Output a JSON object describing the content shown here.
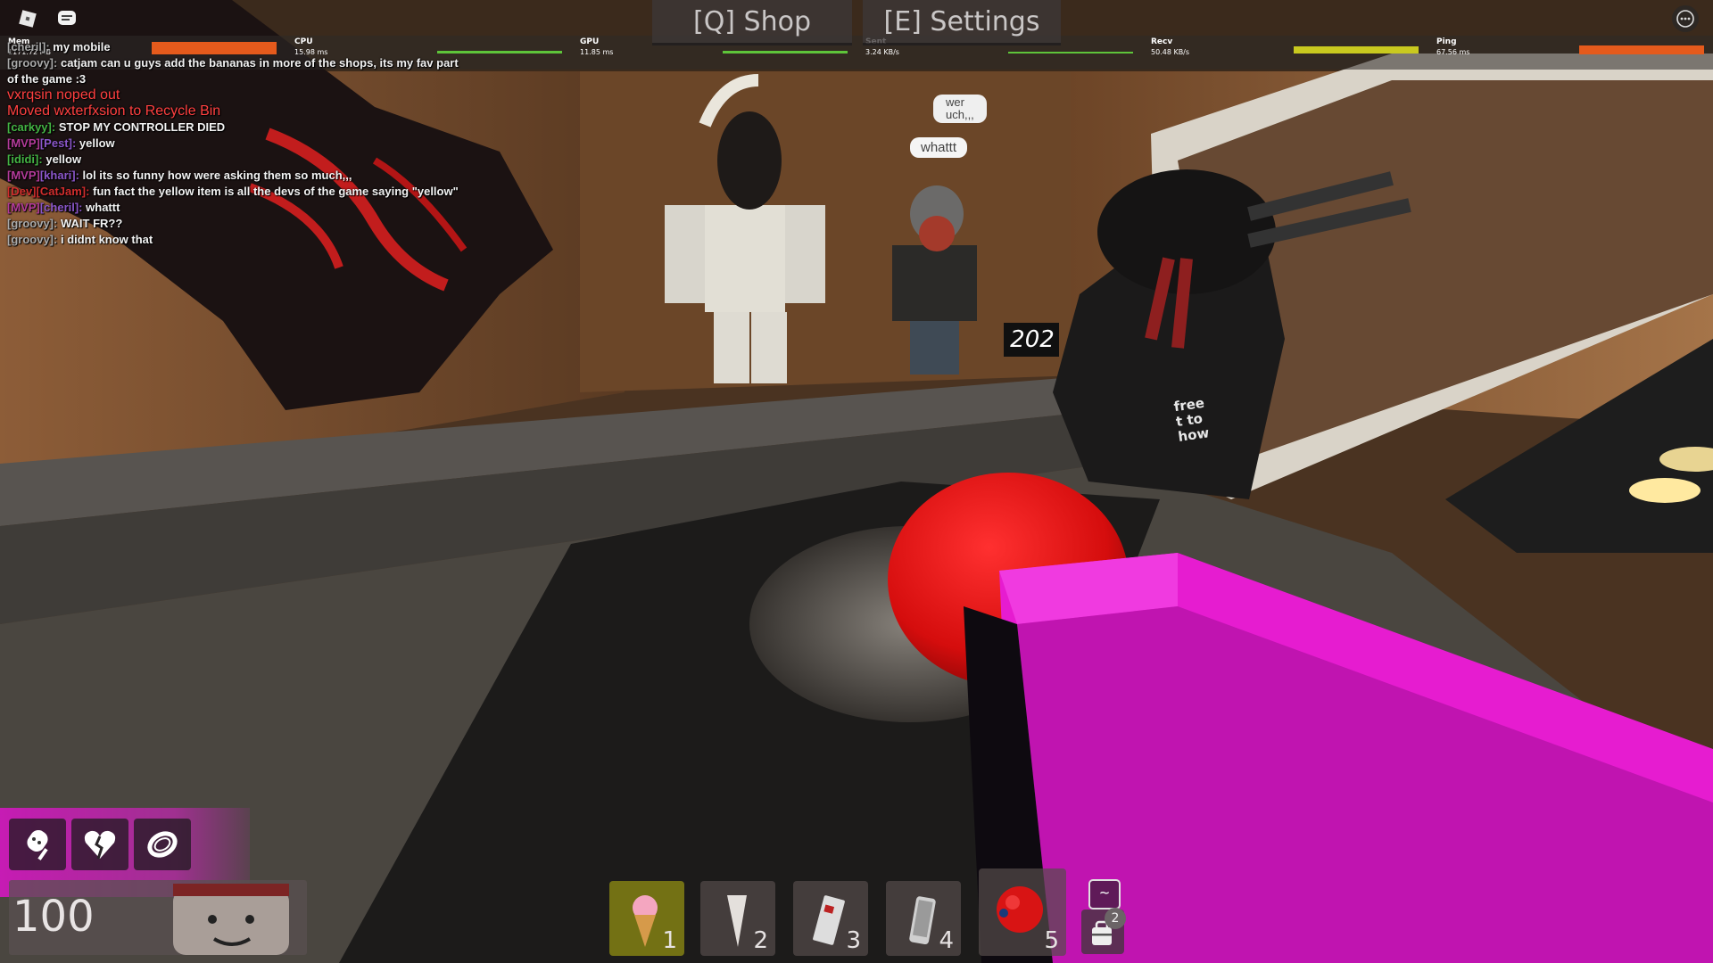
{
  "top_menu": {
    "shop_label": "[Q] Shop",
    "settings_label": "[E] Settings"
  },
  "stats": {
    "mem": {
      "label": "Mem",
      "value": "1171.72 MB"
    },
    "cpu": {
      "label": "CPU",
      "value": "15.98 ms"
    },
    "gpu": {
      "label": "GPU",
      "value": "11.85 ms"
    },
    "sent": {
      "label": "Sent",
      "value": "3.24 KB/s"
    },
    "recv": {
      "label": "Recv",
      "value": "50.48 KB/s"
    },
    "ping": {
      "label": "Ping",
      "value": "67.56 ms"
    }
  },
  "chat": {
    "messages": [
      {
        "tag": "",
        "name": "[cheril]:",
        "text": "my mobile"
      },
      {
        "tag": "",
        "name": "[groovy]:",
        "text": "catjam can u guys add the bananas in more of the shops, its my fav part"
      },
      {
        "tag": "",
        "name": "",
        "text": "of the game :3"
      },
      {
        "tag": "",
        "name": "",
        "text": "vxrqsin noped out",
        "system": true
      },
      {
        "tag": "",
        "name": "",
        "text": "Moved wxterfxsion to Recycle Bin",
        "system": true
      },
      {
        "tag": "",
        "name": "[carkyy]:",
        "text": "STOP MY CONTROLLER DIED"
      },
      {
        "tag": "[MVP]",
        "name": "[Pest]:",
        "text": "yellow"
      },
      {
        "tag": "",
        "name": "[ididi]:",
        "text": "yellow"
      },
      {
        "tag": "[MVP]",
        "name": "[khari]:",
        "text": "lol its so funny how were asking them so much,,,"
      },
      {
        "tag": "[Dev]",
        "name": "[CatJam]:",
        "text": "fun fact the yellow item is all the devs of the game saying \"yellow\""
      },
      {
        "tag": "[MVP]",
        "name": "[cheril]:",
        "text": "whattt"
      },
      {
        "tag": "",
        "name": "[groovy]:",
        "text": "WAIT FR??"
      },
      {
        "tag": "",
        "name": "[groovy]:",
        "text": "i didnt know that"
      }
    ]
  },
  "bubbles": {
    "top": "wer\nuch,,,",
    "main": "whattt"
  },
  "world": {
    "room_number": "202",
    "poster_text": "free\nt to\nhow"
  },
  "hud": {
    "health": "100",
    "abilities": [
      "ice-cream-pop-icon",
      "broken-heart-icon",
      "ring-icon"
    ],
    "hotbar": [
      {
        "num": "1",
        "icon": "ice-cream-cone-icon",
        "selected": true
      },
      {
        "num": "2",
        "icon": "cone-icon",
        "selected": false
      },
      {
        "num": "3",
        "icon": "card-icon",
        "selected": false
      },
      {
        "num": "4",
        "icon": "phone-icon",
        "selected": false
      },
      {
        "num": "5",
        "icon": "red-ball-icon",
        "selected": false
      }
    ],
    "backpack_key": "~",
    "backpack_count": "2"
  },
  "colors": {
    "accent_magenta": "#e61cd0",
    "hotbar_selected": "#82801a",
    "chat_system": "#ff4040"
  }
}
